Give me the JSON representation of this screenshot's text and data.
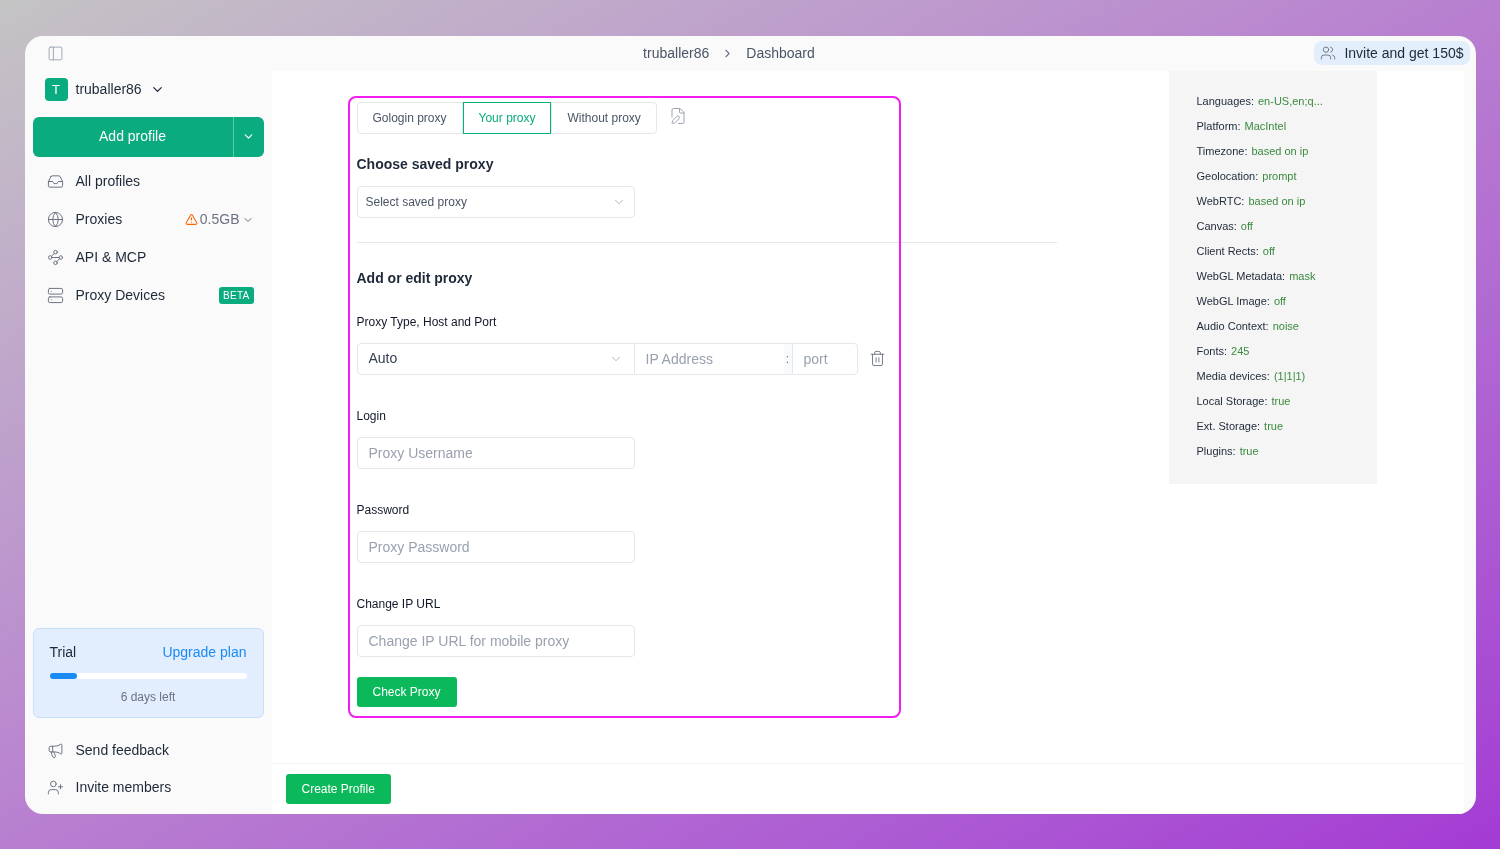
{
  "topbar": {
    "breadcrumb": [
      "truballer86",
      "Dashboard"
    ],
    "invite": "Invite and get 150$"
  },
  "sidebar": {
    "workspace": {
      "initial": "T",
      "name": "truballer86"
    },
    "add_profile": "Add profile",
    "items": [
      {
        "kind": "inbox",
        "label": "All profiles"
      },
      {
        "kind": "globe",
        "label": "Proxies",
        "extra": "0.5GB"
      },
      {
        "kind": "api",
        "label": "API & MCP"
      },
      {
        "kind": "server",
        "label": "Proxy Devices",
        "badge": "BETA"
      }
    ],
    "trial": {
      "label": "Trial",
      "link": "Upgrade plan",
      "level": 0.14,
      "note": "6 days left"
    },
    "footer": [
      {
        "kind": "megaphone",
        "label": "Send feedback"
      },
      {
        "kind": "user-plus",
        "label": "Invite members"
      }
    ]
  },
  "proxy_tabs": [
    {
      "label": "Gologin proxy",
      "selected": false
    },
    {
      "label": "Your proxy",
      "selected": true
    },
    {
      "label": "Without proxy",
      "selected": false
    }
  ],
  "saved": {
    "title": "Choose saved proxy",
    "placeholder": "Select saved proxy"
  },
  "edit": {
    "title": "Add or edit proxy",
    "type_label": "Proxy Type, Host and Port",
    "type_value": "Auto",
    "host_placeholder": "IP Address",
    "colon": ":",
    "port_placeholder": "port",
    "fields": [
      {
        "label": "Login",
        "placeholder": "Proxy Username"
      },
      {
        "label": "Password",
        "placeholder": "Proxy Password"
      },
      {
        "label": "Change IP URL",
        "placeholder": "Change IP URL for mobile proxy"
      }
    ],
    "check": "Check Proxy"
  },
  "fingerprint": [
    {
      "key": "Languages:",
      "value": "en-US,en;q..."
    },
    {
      "key": "Platform:",
      "value": "MacIntel"
    },
    {
      "key": "Timezone:",
      "value": "based on ip"
    },
    {
      "key": "Geolocation:",
      "value": "prompt"
    },
    {
      "key": "WebRTC:",
      "value": "based on ip"
    },
    {
      "key": "Canvas:",
      "value": "off"
    },
    {
      "key": "Client Rects:",
      "value": "off"
    },
    {
      "key": "WebGL Metadata:",
      "value": "mask"
    },
    {
      "key": "WebGL Image:",
      "value": "off"
    },
    {
      "key": "Audio Context:",
      "value": "noise"
    },
    {
      "key": "Fonts:",
      "value": "245"
    },
    {
      "key": "Media devices:",
      "value": "(1|1|1)"
    },
    {
      "key": "Local Storage:",
      "value": "true"
    },
    {
      "key": "Ext. Storage:",
      "value": "true"
    },
    {
      "key": "Plugins:",
      "value": "true"
    }
  ],
  "create": "Create Profile"
}
